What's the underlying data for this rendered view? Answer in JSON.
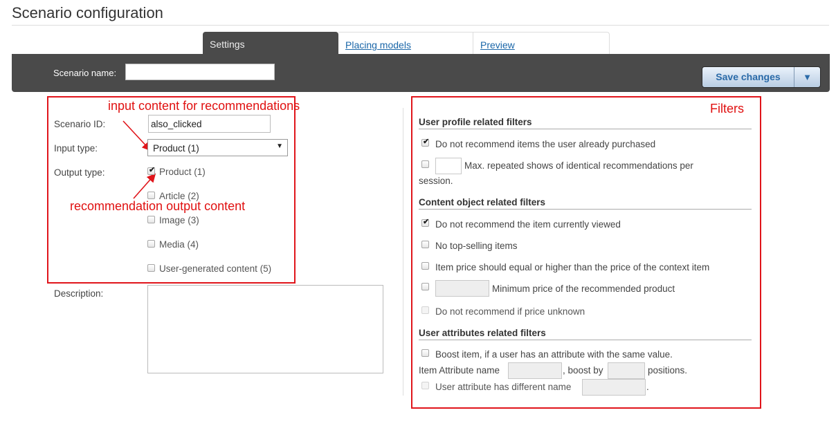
{
  "page": {
    "title": "Scenario configuration"
  },
  "tabs": [
    {
      "label": "Settings",
      "active": true
    },
    {
      "label": "Placing models",
      "active": false
    },
    {
      "label": "Preview",
      "active": false
    }
  ],
  "toolbar": {
    "scenario_name_label": "Scenario name:",
    "scenario_name_value": "",
    "save_label": "Save changes",
    "dropdown_arrow": "▼"
  },
  "annotations": {
    "input_note": "input content for recommendations",
    "output_note": "recommendation output content",
    "filters_note": "Filters",
    "color": "#e0141a"
  },
  "settings": {
    "scenario_id_label": "Scenario ID:",
    "scenario_id_value": "also_clicked",
    "input_type_label": "Input type:",
    "input_type_value": "Product (1)",
    "output_type_label": "Output type:",
    "output_options": [
      {
        "label": "Product (1)",
        "checked": true
      },
      {
        "label": "Article (2)",
        "checked": false
      },
      {
        "label": "Image (3)",
        "checked": false
      },
      {
        "label": "Media (4)",
        "checked": false
      },
      {
        "label": "User-generated content (5)",
        "checked": false
      }
    ],
    "description_label": "Description:",
    "description_value": ""
  },
  "filters": {
    "user_profile": {
      "title": "User profile related filters",
      "no_purchased": {
        "label": "Do not recommend items the user already purchased",
        "checked": true
      },
      "max_repeated": {
        "label_line1": "Max. repeated shows of identical recommendations per",
        "label_line2": "session.",
        "checked": false,
        "value": ""
      }
    },
    "content_object": {
      "title": "Content object related filters",
      "no_current": {
        "label": "Do not recommend the item currently viewed",
        "checked": true
      },
      "no_top_selling": {
        "label": "No top-selling items",
        "checked": false
      },
      "price_equal_higher": {
        "label": "Item price should equal or higher than the price of the context item",
        "checked": false
      },
      "min_price": {
        "label": "Minimum price of the recommended product",
        "checked": false,
        "value": ""
      },
      "price_unknown": {
        "label": "Do not recommend if price unknown",
        "checked": false,
        "disabled": true
      }
    },
    "user_attributes": {
      "title": "User attributes related filters",
      "boost": {
        "label": "Boost item, if a user has an attribute with the same value.",
        "checked": false
      },
      "item_attr_label": "Item Attribute name",
      "boost_by_label": ", boost by",
      "positions_label": "positions.",
      "different_name": {
        "label": "User attribute has different name",
        "checked": false,
        "disabled": true,
        "trailing": "."
      }
    }
  }
}
